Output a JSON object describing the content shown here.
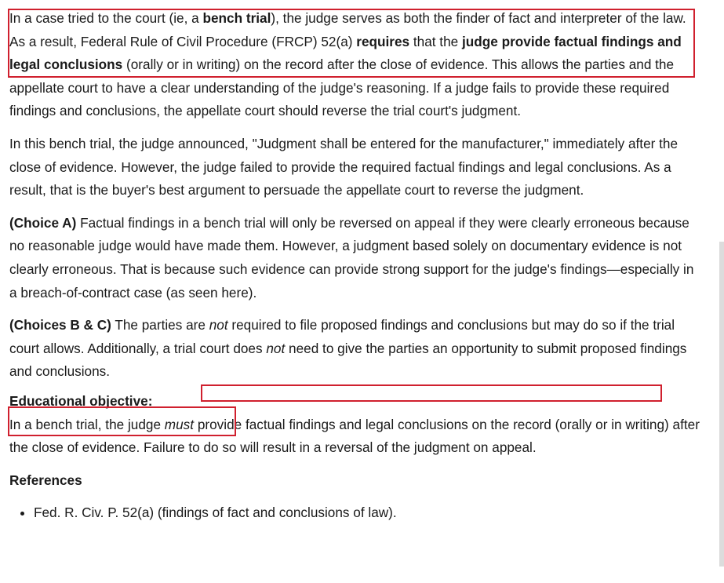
{
  "explanation": {
    "p1": {
      "s1": "In a case tried to the court (ie, a ",
      "s2": "bench trial",
      "s3": "), the judge serves as both the finder of fact and interpreter of the law.  As a result, Federal Rule of Civil Procedure (FRCP) 52(a) ",
      "s4": "requires",
      "s5": " that the ",
      "s6": "judge provide factual findings and legal conclusions",
      "s7": " (orally or in writing) on the record after the close of evidence.  This allows the parties and the appellate court to have a clear understanding of the judge's reasoning.  If a judge fails to provide these required findings and conclusions, the appellate court should reverse the trial court's judgment."
    },
    "p2": "In this bench trial, the judge announced, \"Judgment shall be entered for the manufacturer,\" immediately after the close of evidence.  However, the judge failed to provide the required factual findings and legal conclusions.  As a result, that is the buyer's best argument to persuade the appellate court to reverse the judgment.",
    "choice_a": {
      "label": "(Choice A)",
      "text": "  Factual findings in a bench trial will only be reversed on appeal if they were clearly erroneous because no reasonable judge would have made them.  However, a judgment based solely on documentary evidence is not clearly erroneous.  That is because such evidence can provide strong support for the judge's findings—especially in a breach-of-contract case (as seen here)."
    },
    "choice_bc": {
      "label": "(Choices B & C)",
      "s1": "  The parties are ",
      "s2": "not",
      "s3": " required to file proposed findings and conclusions but may do so if the trial court allows.  Additionally, a trial court does ",
      "s4": "not",
      "s5": " need to give the parties an opportunity to submit proposed findings and conclusions."
    }
  },
  "educational_objective": {
    "heading": "Educational objective:",
    "s1": "In a bench trial, the judge ",
    "s2": "must",
    "s3": " provide factual findings and legal conclusions on the record (orally or in writing) after the close of evidence.  Failure to do so will result in a reversal of the judgment on appeal."
  },
  "references": {
    "heading": "References",
    "items": [
      "Fed. R. Civ. P. 52(a) (findings of fact and conclusions of law)."
    ]
  },
  "colors": {
    "highlight_border": "#d0202e",
    "text": "#1a1a1a",
    "scrollbar_thumb": "#dcdcdc"
  }
}
